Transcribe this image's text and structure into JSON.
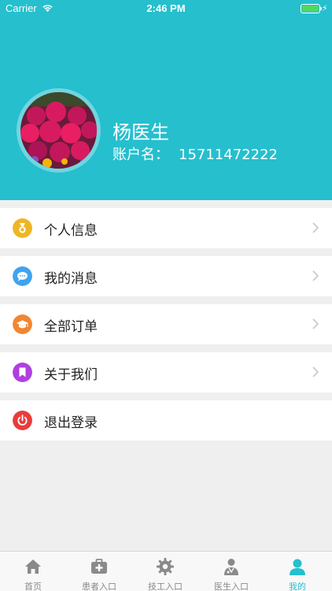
{
  "status_bar": {
    "carrier": "Carrier",
    "time": "2:46 PM"
  },
  "profile": {
    "name": "杨医生",
    "account_label": "账户名：",
    "account_value": "15711472222"
  },
  "menu": [
    {
      "label": "个人信息",
      "icon": "medal-icon",
      "color": "#efb524",
      "has_arrow": true
    },
    {
      "label": "我的消息",
      "icon": "chat-bubble-icon",
      "color": "#40a3ef",
      "has_arrow": true
    },
    {
      "label": "全部订单",
      "icon": "graduation-cap-icon",
      "color": "#f1862f",
      "has_arrow": true
    },
    {
      "label": "关于我们",
      "icon": "bookmark-icon",
      "color": "#b03fe2",
      "has_arrow": true
    },
    {
      "label": "退出登录",
      "icon": "power-icon",
      "color": "#ea3c3c",
      "has_arrow": false
    }
  ],
  "tabs": [
    {
      "label": "首页",
      "icon": "home-icon",
      "active": false
    },
    {
      "label": "患者入口",
      "icon": "medical-kit-icon",
      "active": false
    },
    {
      "label": "技工入口",
      "icon": "gear-icon",
      "active": false
    },
    {
      "label": "医生入口",
      "icon": "doctor-icon",
      "active": false
    },
    {
      "label": "我的",
      "icon": "user-icon",
      "active": true
    }
  ],
  "colors": {
    "header_bg": "#25bfce",
    "accent": "#25bfce",
    "tab_inactive": "#8a8a8a"
  }
}
